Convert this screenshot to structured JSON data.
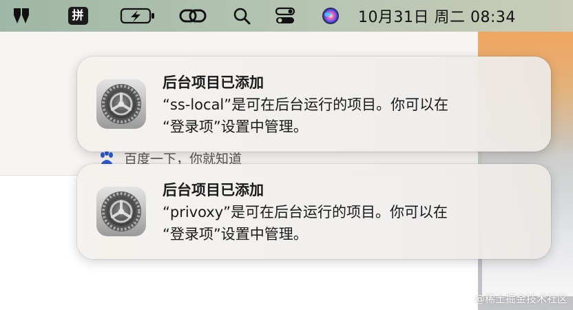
{
  "menubar": {
    "ime_label": "拼",
    "datetime": "10月31日 周二  08:34",
    "icons": [
      "app-logo-icon",
      "battery-charging-icon",
      "link-icon",
      "search-icon",
      "control-center-icon",
      "siri-icon"
    ]
  },
  "background": {
    "search_result": "百度一下，你就知道",
    "watermark": "@稀土掘金技术社区"
  },
  "notifications": [
    {
      "title": "后台项目已添加",
      "line1": "“ss-local”是可在后台运行的项目。你可以在",
      "line2": "“登录项”设置中管理。",
      "icon": "system-settings-gear-icon"
    },
    {
      "title": "后台项目已添加",
      "line1": "“privoxy”是可在后台运行的项目。你可以在",
      "line2": "“登录项”设置中管理。",
      "icon": "system-settings-gear-icon"
    }
  ]
}
